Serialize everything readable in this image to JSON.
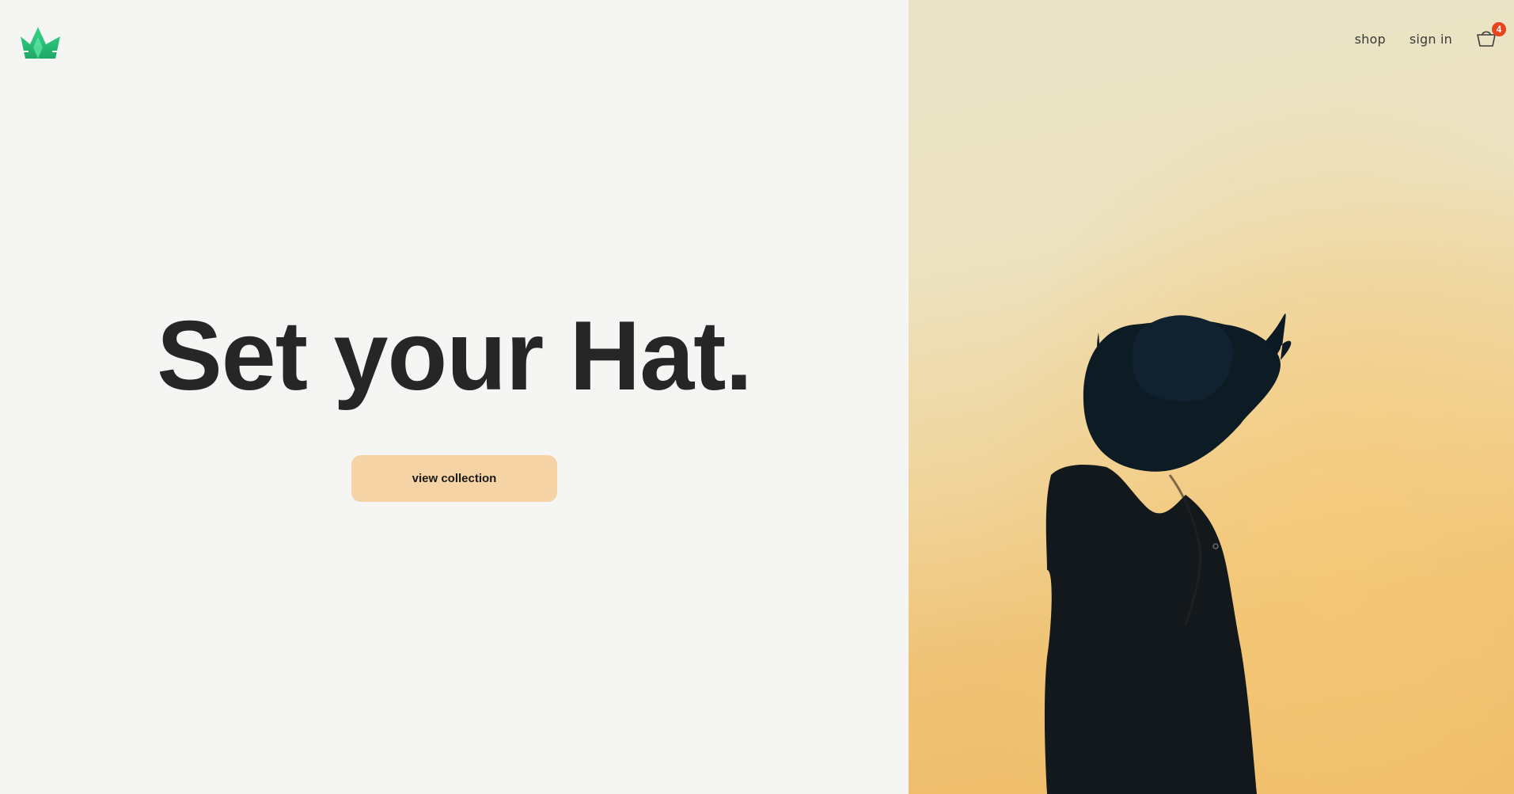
{
  "header": {
    "logo_icon": "crown-icon",
    "nav": {
      "shop_label": "shop",
      "signin_label": "sign in",
      "cart_icon": "basket-icon",
      "cart_count": "4"
    }
  },
  "hero": {
    "title": "Set your Hat.",
    "cta_label": "view collection"
  },
  "colors": {
    "background": "#f5f5f3",
    "accent_button": "#f5d3a4",
    "logo_green": "#2bbf73",
    "badge": "#e8431b",
    "title_text": "#262626"
  },
  "image": {
    "subject": "person-in-hat-icon"
  }
}
